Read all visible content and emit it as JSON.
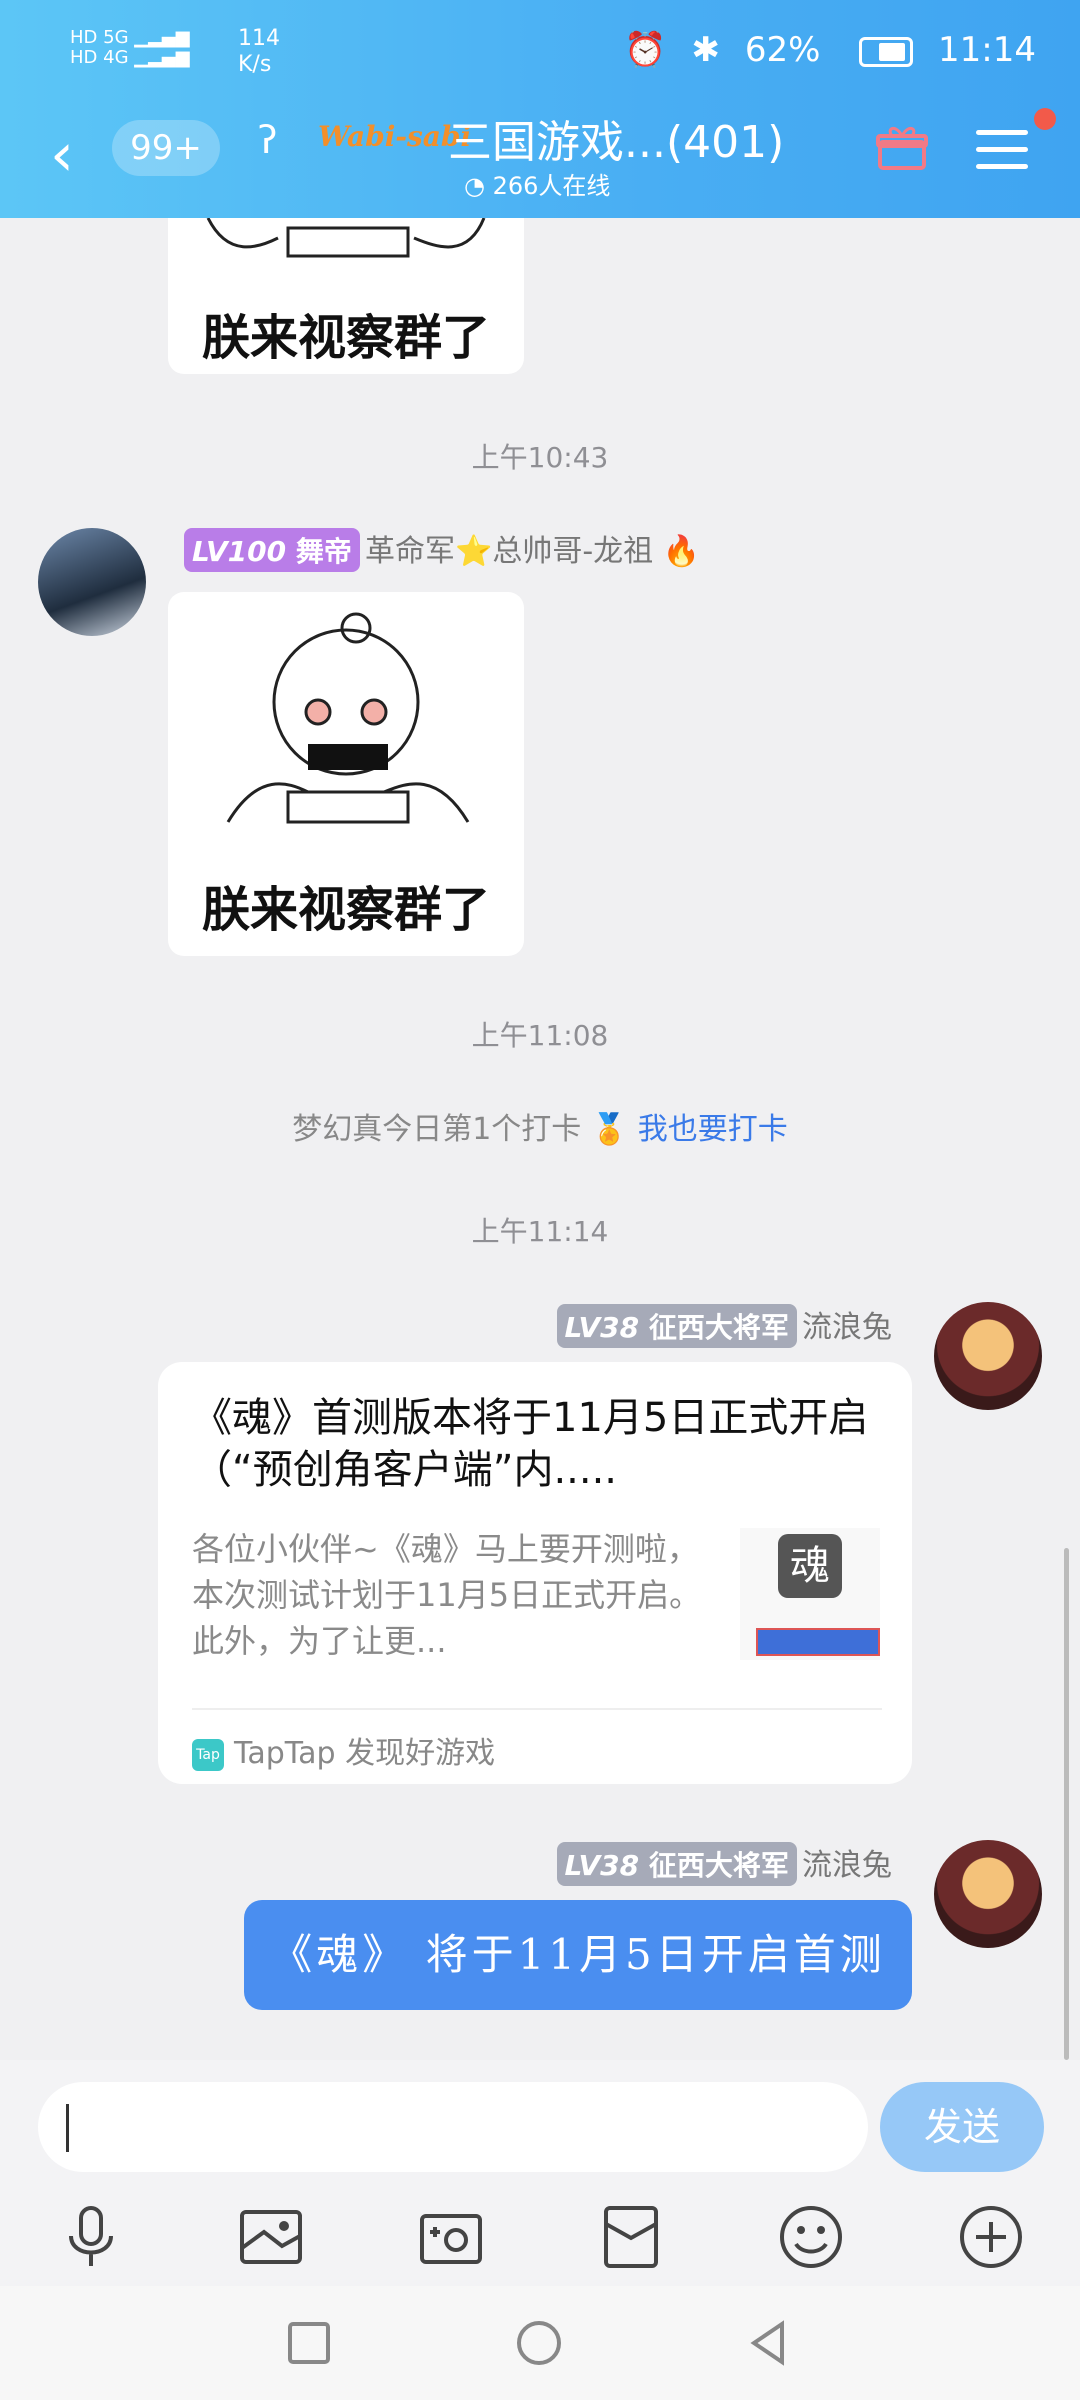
{
  "status": {
    "signal_text": "HD 5G 4G",
    "speed": "114\nK/s",
    "battery": "62%",
    "time": "11:14",
    "battery_level": 0.62
  },
  "header": {
    "badge": "99+",
    "logo": "Wabi-sabi",
    "title": "三国游戏...(401)",
    "online": "266人在线"
  },
  "messages": {
    "sticker_caption_1": "朕来视察群了",
    "time_1": "上午10:43",
    "user1": {
      "level": "LV100",
      "title": "舞帝",
      "name": "革命军⭐总帅哥-龙祖 🔥"
    },
    "sticker_caption_2": "朕来视察群了",
    "time_2": "上午11:08",
    "checkin_text": "梦幻真今日第1个打卡",
    "checkin_link": "我也要打卡",
    "time_3": "上午11:14",
    "user2": {
      "level": "LV38",
      "title": "征西大将军",
      "name": "流浪兔"
    },
    "share": {
      "title": "《魂》首测版本将于11月5日正式开启（“预创角客户端”内.....",
      "desc": "各位小伙伴~《魂》马上要开测啦，本次测试计划于11月5日正式开启。此外，为了让更...",
      "source": "TapTap 发现好游戏",
      "source_icon": "Tap"
    },
    "user3": {
      "level": "LV38",
      "title": "征西大将军",
      "name": "流浪兔"
    },
    "bubble_text": "《魂》 将于11月5日开启首测"
  },
  "input": {
    "placeholder": "",
    "send_label": "发送"
  }
}
